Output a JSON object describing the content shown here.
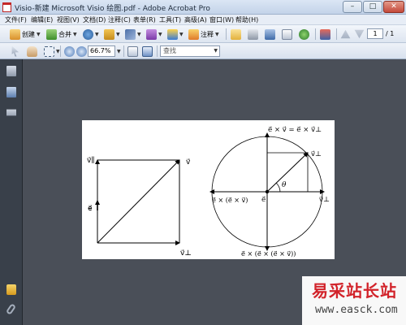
{
  "window": {
    "title": "Visio-新建 Microsoft Visio 绘图.pdf - Adobe Acrobat Pro",
    "min_glyph": "–",
    "max_glyph": "□",
    "close_glyph": "✕"
  },
  "menu": [
    "文件(F)",
    "编辑(E)",
    "视图(V)",
    "文档(D)",
    "注释(C)",
    "表单(R)",
    "工具(T)",
    "高级(A)",
    "窗口(W)",
    "帮助(H)"
  ],
  "toolbar": {
    "create_label": "创建",
    "combine_label": "合并",
    "sign_label": "注释",
    "page_current": "1",
    "page_total": "/ 1"
  },
  "toolbar2": {
    "zoom": "66.7%",
    "find_placeholder": "查找"
  },
  "figure": {
    "left": {
      "v_parallel": "v⃗∥",
      "v": "v⃗",
      "e": "e⃗",
      "v_perp": "v⃗⊥"
    },
    "right": {
      "top": "e⃗ × v⃗ = e⃗ × v⃗⊥",
      "v_perp_top": "v⃗⊥",
      "v_perp_right": "v⃗⊥",
      "theta": "θ",
      "e": "e⃗",
      "left_label": "e⃗ × (e⃗ × v⃗)",
      "bottom_label": "e⃗ × (e⃗ × (e⃗ × v⃗))"
    }
  },
  "watermark": {
    "main": "易采站长站",
    "url": "www.easck.com"
  }
}
